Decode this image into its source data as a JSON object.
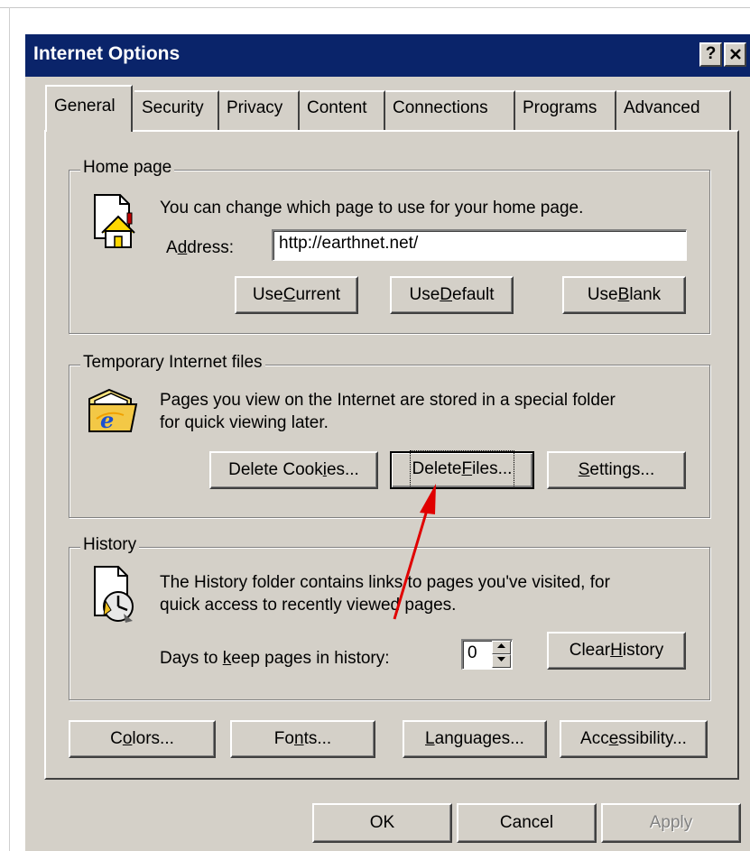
{
  "window": {
    "title": "Internet Options",
    "help_label": "?",
    "close_label": "✕"
  },
  "tabs": [
    {
      "label": "General",
      "active": true
    },
    {
      "label": "Security"
    },
    {
      "label": "Privacy"
    },
    {
      "label": "Content"
    },
    {
      "label": "Connections"
    },
    {
      "label": "Programs"
    },
    {
      "label": "Advanced"
    }
  ],
  "home_page": {
    "legend": "Home page",
    "description": "You can change which page to use for your home page.",
    "address_label_pre": "A",
    "address_label_ul": "d",
    "address_label_post": "dress:",
    "address_value": "http://earthnet.net/",
    "use_current_pre": "Use ",
    "use_current_ul": "C",
    "use_current_post": "urrent",
    "use_default_pre": "Use ",
    "use_default_ul": "D",
    "use_default_post": "efault",
    "use_blank_pre": "Use ",
    "use_blank_ul": "B",
    "use_blank_post": "lank"
  },
  "temp_files": {
    "legend": "Temporary Internet files",
    "description_line1": "Pages you view on the Internet are stored in a special folder",
    "description_line2": "for quick viewing later.",
    "delete_cookies_pre": "Delete Cook",
    "delete_cookies_ul": "i",
    "delete_cookies_post": "es...",
    "delete_files_pre": "Delete ",
    "delete_files_ul": "F",
    "delete_files_post": "iles...",
    "settings_pre": "",
    "settings_ul": "S",
    "settings_post": "ettings..."
  },
  "history": {
    "legend": "History",
    "description_line1": "The History folder contains links to pages you've visited, for",
    "description_line2": "quick access to recently viewed pages.",
    "days_label_pre": "Days to ",
    "days_label_ul": "k",
    "days_label_post": "eep pages in history:",
    "days_value": "0",
    "clear_history_pre": "Clear ",
    "clear_history_ul": "H",
    "clear_history_post": "istory"
  },
  "bottom_buttons": {
    "colors_pre": "C",
    "colors_ul": "o",
    "colors_post": "lors...",
    "fonts_pre": "Fo",
    "fonts_ul": "n",
    "fonts_post": "ts...",
    "languages_pre": "",
    "languages_ul": "L",
    "languages_post": "anguages...",
    "accessibility_pre": "Acc",
    "accessibility_ul": "e",
    "accessibility_post": "ssibility..."
  },
  "dialog_buttons": {
    "ok": "OK",
    "cancel": "Cancel",
    "apply": "Apply"
  },
  "colors": {
    "titlebar": "#0a246a",
    "face": "#d4d0c8",
    "annotation_arrow": "#e00000"
  }
}
